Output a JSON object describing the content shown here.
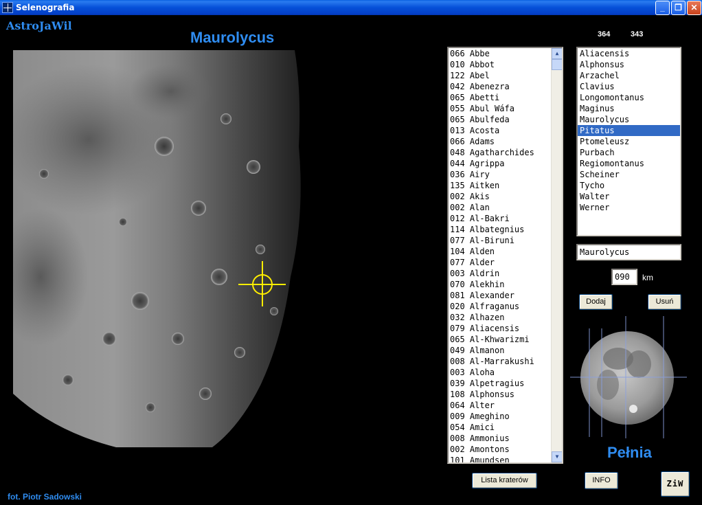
{
  "window": {
    "title": "Selenografia"
  },
  "brand": "AstroJaWil",
  "crater_title": "Maurolycus",
  "credit": "fot. Piotr Sadowski",
  "counters": [
    "364",
    "343"
  ],
  "crater_list": [
    "066 Abbe",
    "010 Abbot",
    "122 Abel",
    "042 Abenezra",
    "065 Abetti",
    "055 Abul Wáfa",
    "065 Abulfeda",
    "013 Acosta",
    "066 Adams",
    "048 Agatharchides",
    "044 Agrippa",
    "036 Airy",
    "135 Aitken",
    "002 Akis",
    "002 Alan",
    "012 Al-Bakri",
    "114 Albategnius",
    "077 Al-Biruni",
    "104 Alden",
    "077 Alder",
    "003 Aldrin",
    "070 Alekhin",
    "081 Alexander",
    "020 Alfraganus",
    "032 Alhazen",
    "079 Aliacensis",
    "065 Al-Khwarizmi",
    "049 Almanon",
    "008 Al-Marrakushi",
    "003 Aloha",
    "039 Alpetragius",
    "108 Alphonsus",
    "064 Alter",
    "009 Ameghino",
    "054 Amici",
    "008 Ammonius",
    "002 Amontons",
    "101 Amundsen"
  ],
  "selected_craters": [
    "Aliacensis",
    "Alphonsus",
    "Arzachel",
    "Clavius",
    "Longomontanus",
    "Maginus",
    "Maurolycus",
    "Pitatus",
    "Ptomeleusz",
    "Purbach",
    "Regiomontanus",
    "Scheiner",
    "Tycho",
    "Walter",
    "Werner"
  ],
  "selected_index": 7,
  "name_field": "Maurolycus",
  "size_field": "090",
  "size_unit": "km",
  "buttons": {
    "add": "Dodaj",
    "remove": "Usuń",
    "crater_list": "Lista kraterów",
    "info": "INFO",
    "ziw": "ZiW"
  },
  "phase_label": "Pełnia",
  "icons": {
    "minimize": "minimize-icon",
    "maximize": "maximize-icon",
    "close": "close-icon",
    "scroll_up": "chevron-up-icon",
    "scroll_down": "chevron-down-icon",
    "crosshair": "crosshair-icon"
  },
  "colors": {
    "accent": "#2f8cf0",
    "selection": "#316ac5",
    "crosshair": "#ffee00"
  }
}
